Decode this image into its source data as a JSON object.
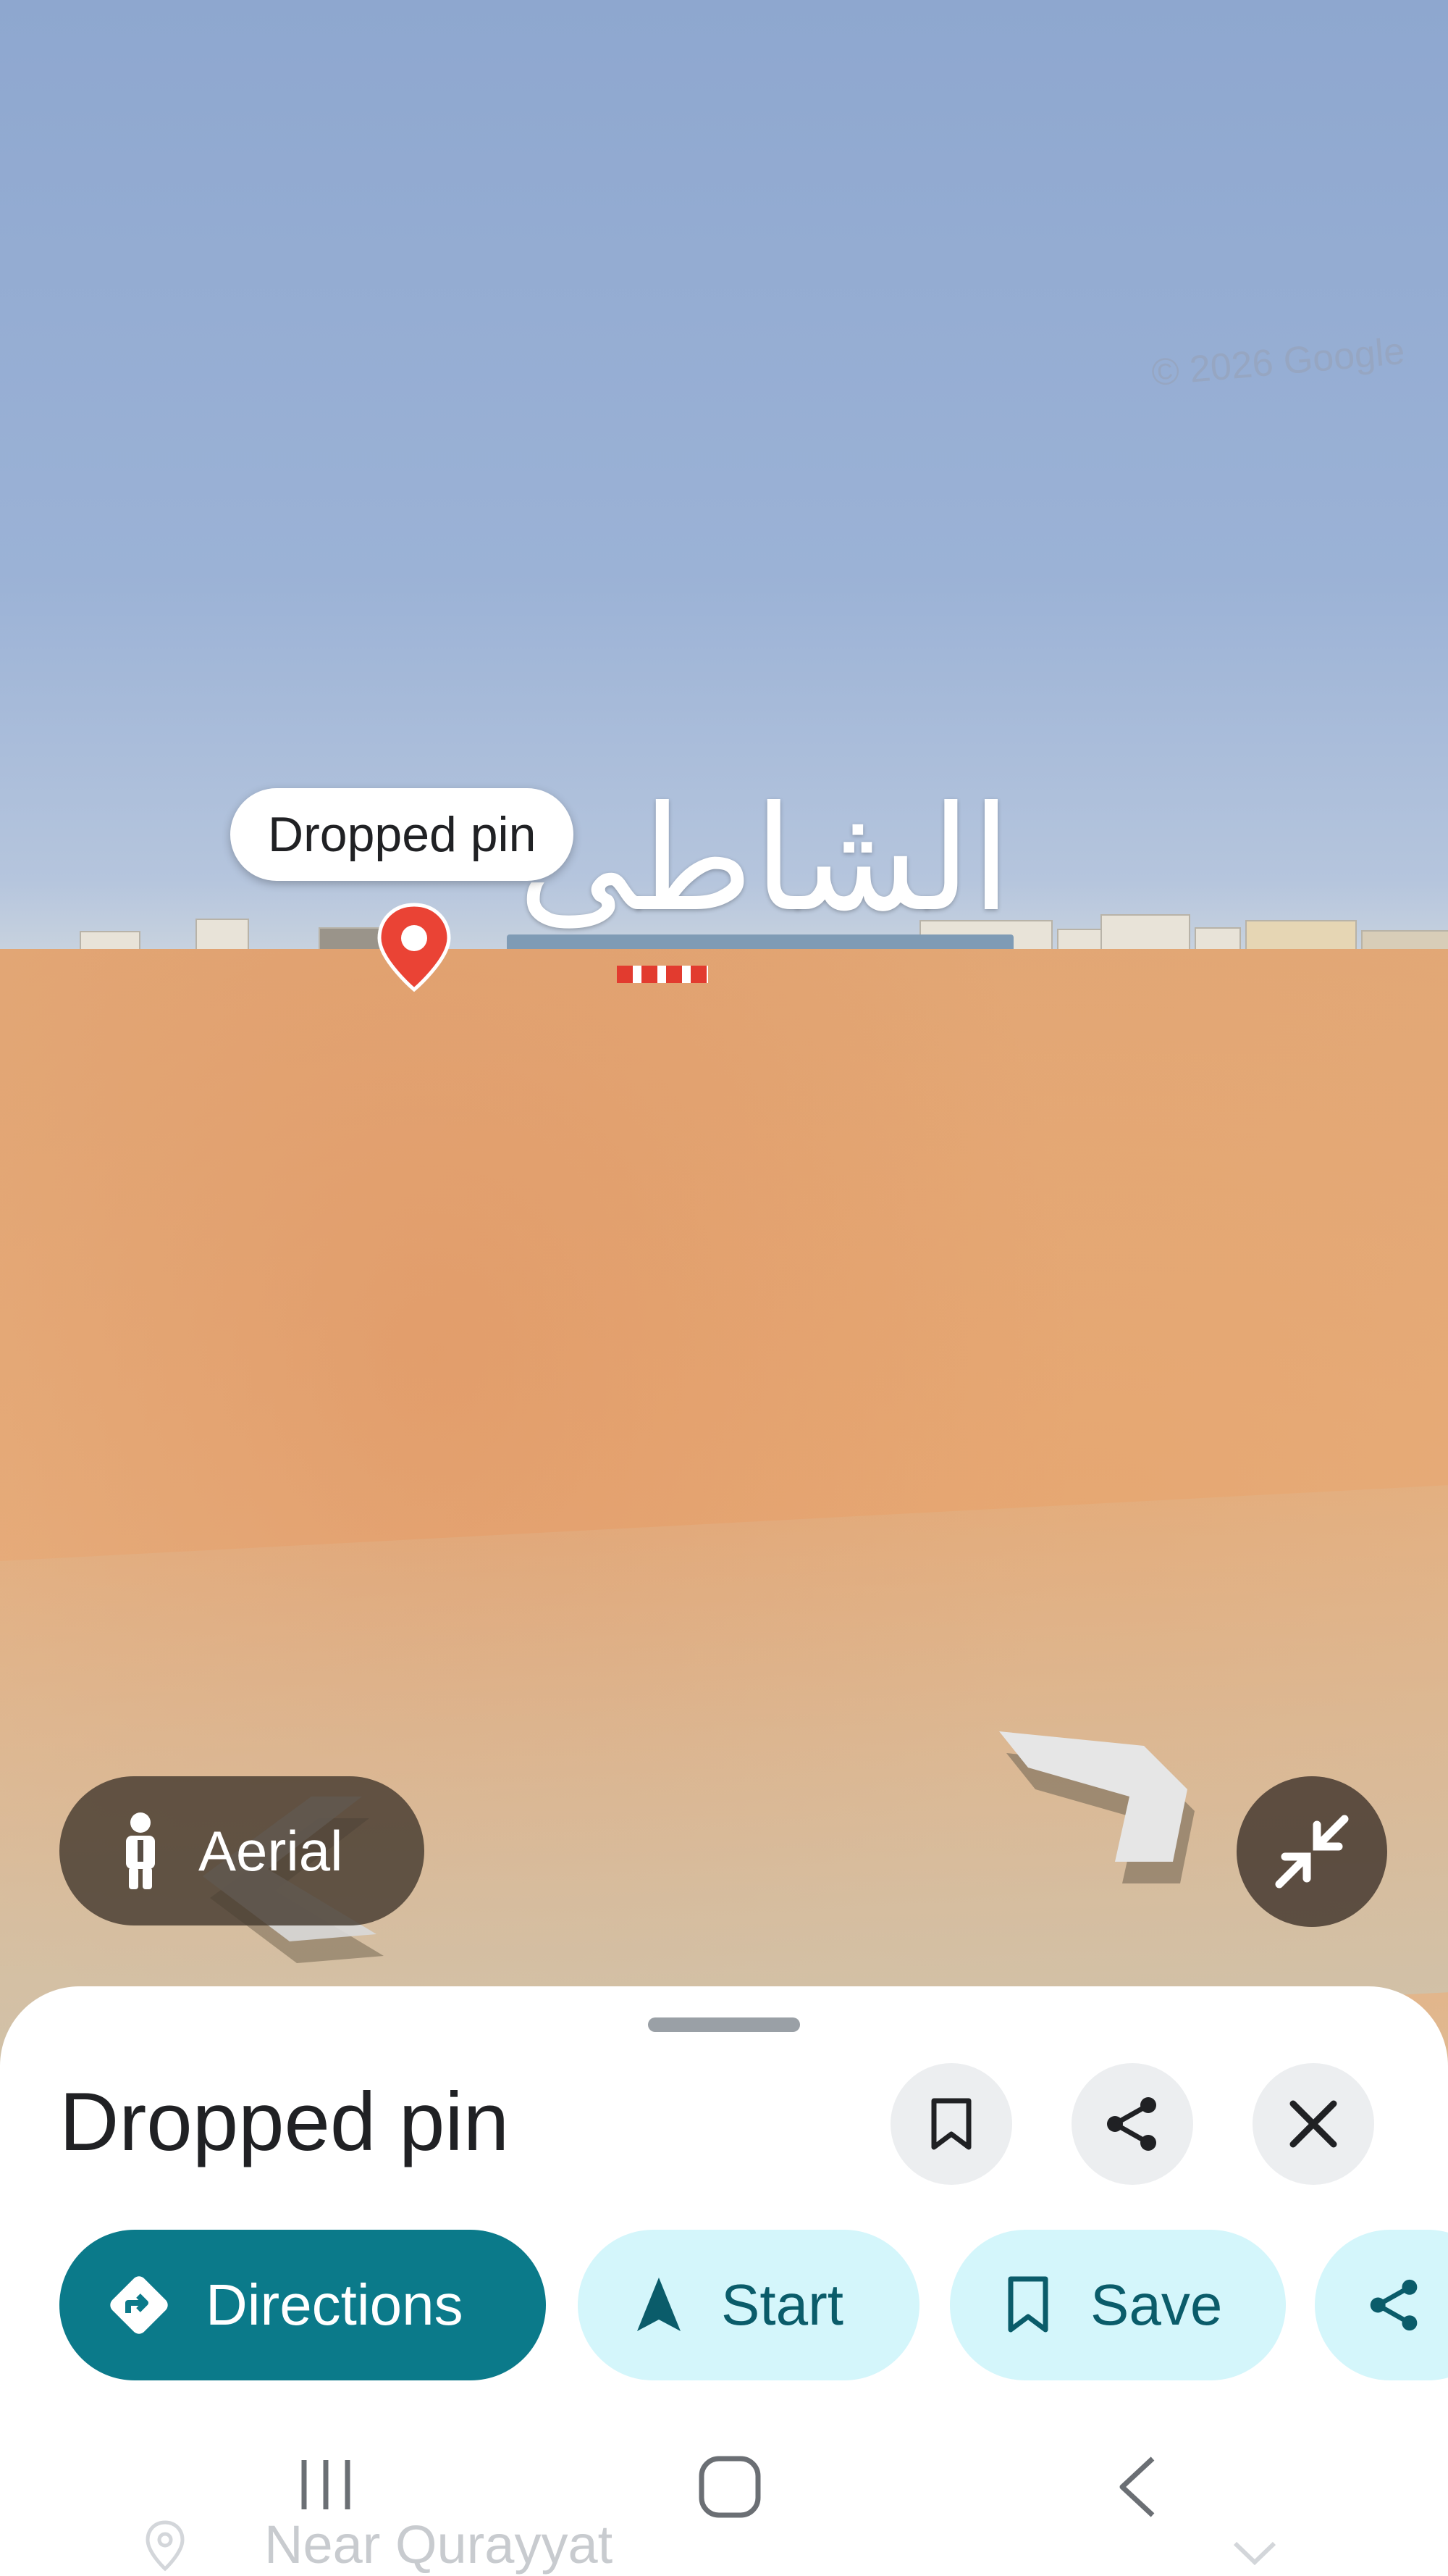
{
  "scene": {
    "copyright": "© 2026 Google",
    "street_label": "الشاطى",
    "pin_label": "Dropped pin"
  },
  "controls": {
    "aerial_label": "Aerial",
    "aerial_icon": "pegman-icon",
    "collapse_icon": "collapse-arrows-icon"
  },
  "sheet": {
    "title": "Dropped pin",
    "header_actions": [
      {
        "icon": "bookmark-icon"
      },
      {
        "icon": "share-icon"
      },
      {
        "icon": "close-icon"
      }
    ],
    "chips": [
      {
        "label": "Directions",
        "icon": "directions-icon",
        "style": "primary"
      },
      {
        "label": "Start",
        "icon": "navigation-arrow-icon",
        "style": "tonal"
      },
      {
        "label": "Save",
        "icon": "bookmark-icon",
        "style": "tonal"
      },
      {
        "label": "",
        "icon": "share-icon",
        "style": "tonal"
      }
    ],
    "behind_row": "Near Qurayyat"
  },
  "colors": {
    "primary": "#0b7a8a",
    "tonal": "#d4f6fb",
    "pin": "#ea4335"
  }
}
